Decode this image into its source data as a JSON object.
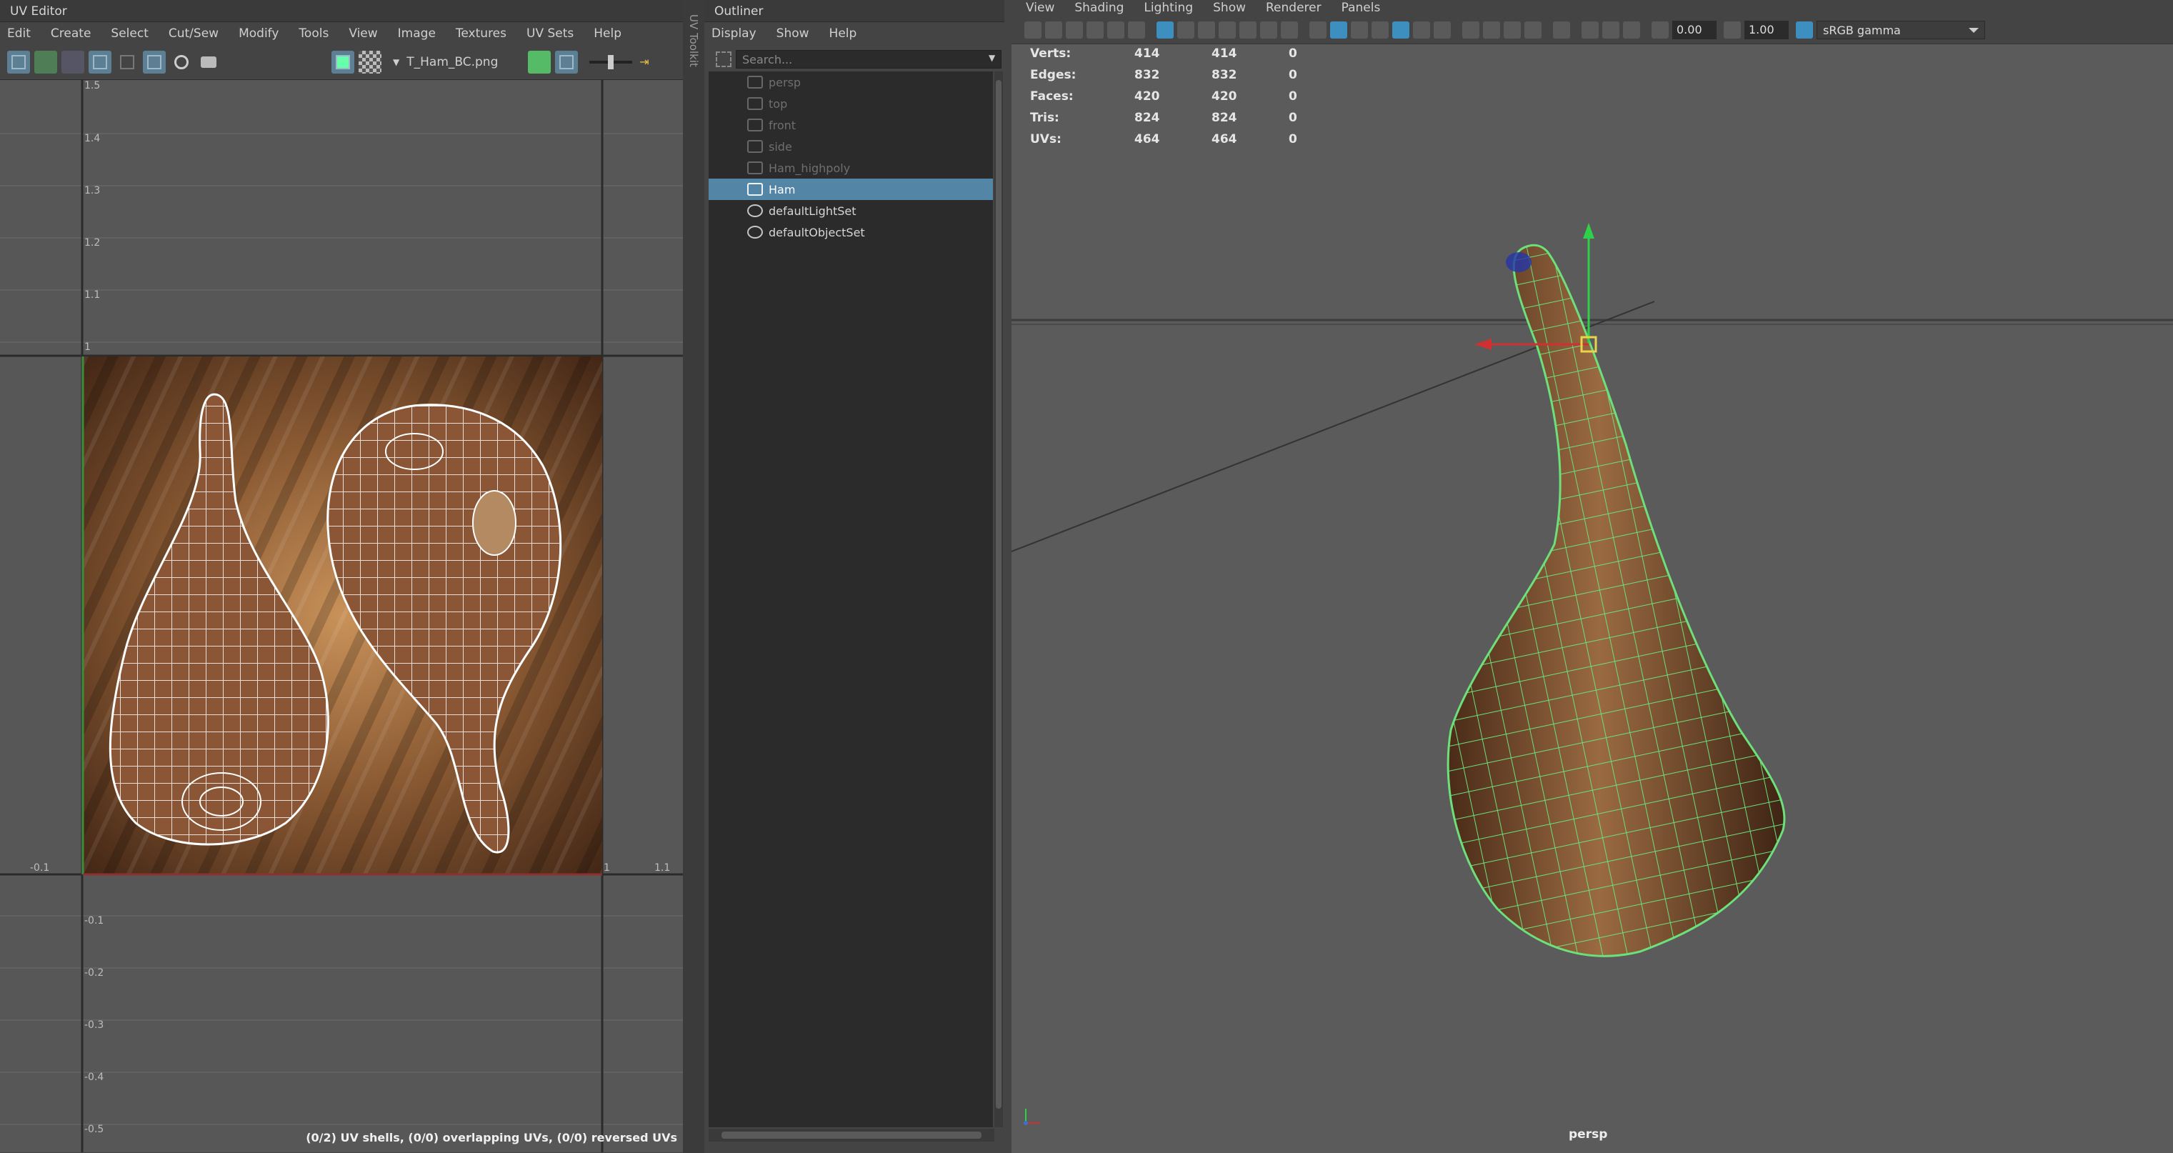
{
  "uv_editor": {
    "title": "UV Editor",
    "menu": [
      "Edit",
      "Create",
      "Select",
      "Cut/Sew",
      "Modify",
      "Tools",
      "View",
      "Image",
      "Textures",
      "UV Sets",
      "Help"
    ],
    "texture_name": "T_Ham_BC.png",
    "side_tab": "UV Toolkit",
    "grid_labels_v": [
      "1.5",
      "1.4",
      "1.3",
      "1.2",
      "1.1",
      "1",
      "-0.1",
      "-0.2",
      "-0.3",
      "-0.4",
      "-0.5"
    ],
    "grid_labels_h": [
      "-0.1",
      "1",
      "1.1"
    ],
    "status": "(0/2) UV shells, (0/0) overlapping UVs, (0/0) reversed UVs"
  },
  "outliner": {
    "title": "Outliner",
    "menu": [
      "Display",
      "Show",
      "Help"
    ],
    "search_placeholder": "Search...",
    "items": [
      {
        "label": "persp",
        "state": "dim"
      },
      {
        "label": "top",
        "state": "dim"
      },
      {
        "label": "front",
        "state": "dim"
      },
      {
        "label": "side",
        "state": "dim"
      },
      {
        "label": "Ham_highpoly",
        "state": "dim"
      },
      {
        "label": "Ham",
        "state": "selected"
      },
      {
        "label": "defaultLightSet",
        "state": "normal"
      },
      {
        "label": "defaultObjectSet",
        "state": "normal"
      }
    ]
  },
  "viewport": {
    "menu": [
      "View",
      "Shading",
      "Lighting",
      "Show",
      "Renderer",
      "Panels"
    ],
    "exposure": "0.00",
    "gamma": "1.00",
    "color_space": "sRGB gamma",
    "camera_label": "persp",
    "stats": [
      {
        "label": "Verts:",
        "a": "414",
        "b": "414",
        "c": "0"
      },
      {
        "label": "Edges:",
        "a": "832",
        "b": "832",
        "c": "0"
      },
      {
        "label": "Faces:",
        "a": "420",
        "b": "420",
        "c": "0"
      },
      {
        "label": "Tris:",
        "a": "824",
        "b": "824",
        "c": "0"
      },
      {
        "label": "UVs:",
        "a": "464",
        "b": "464",
        "c": "0"
      }
    ]
  },
  "colors": {
    "selection": "#5285a6",
    "wire": "#6de07a",
    "accent": "#3d8fbf"
  }
}
